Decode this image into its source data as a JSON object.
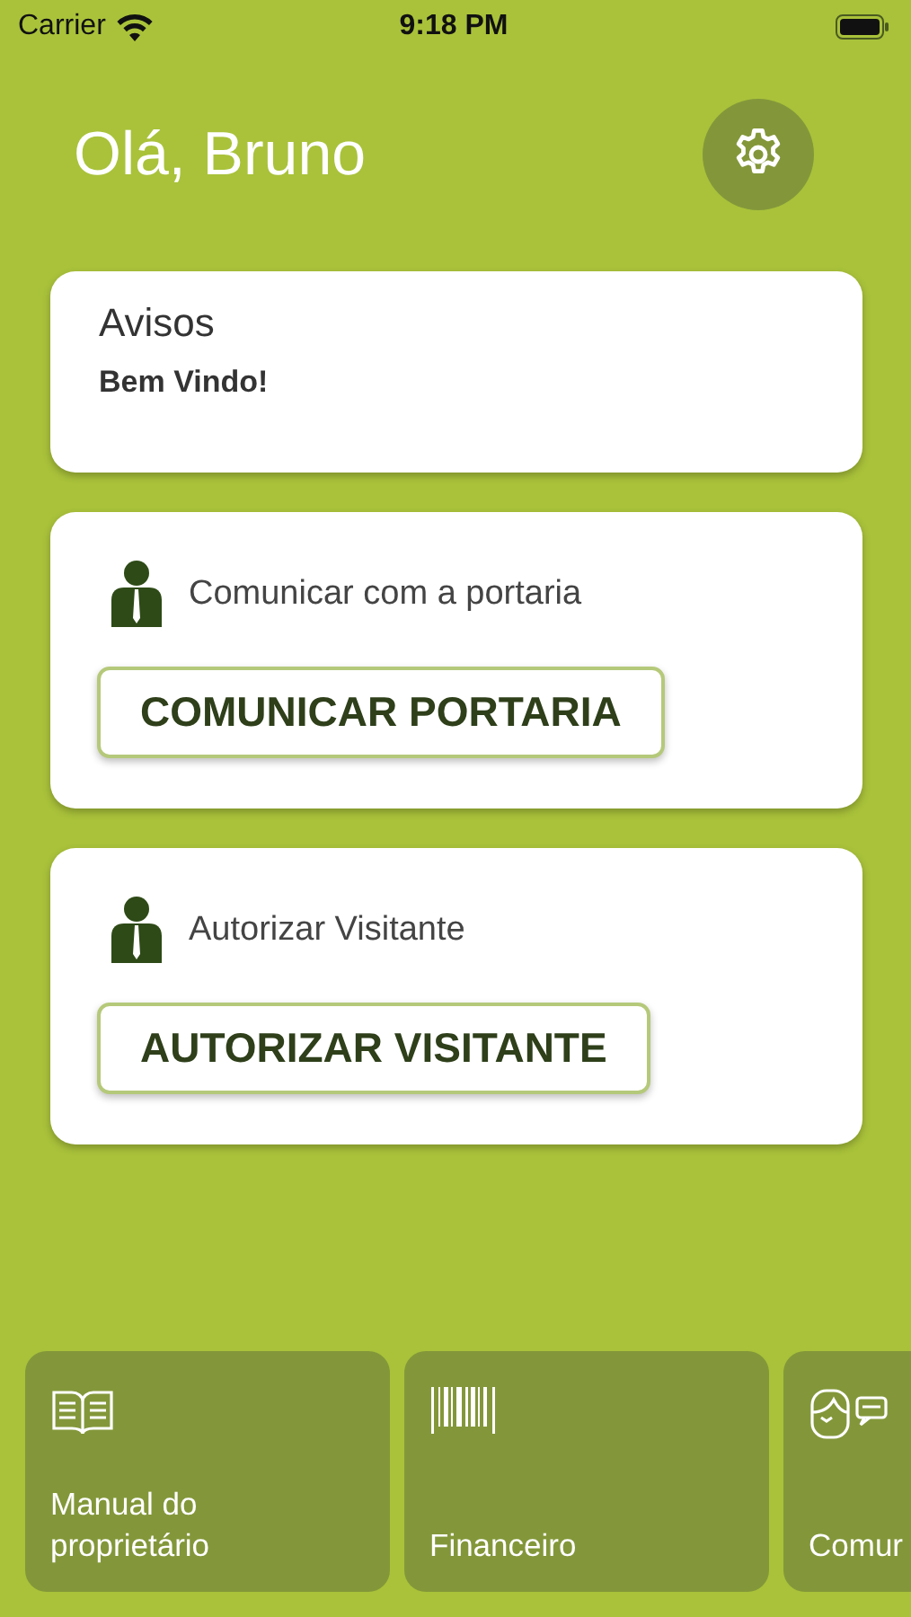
{
  "status_bar": {
    "carrier": "Carrier",
    "time": "9:18 PM"
  },
  "header": {
    "greeting": "Olá, Bruno"
  },
  "notice": {
    "title": "Avisos",
    "message": "Bem Vindo!"
  },
  "actions": [
    {
      "label": "Comunicar com a portaria",
      "button": "COMUNICAR PORTARIA"
    },
    {
      "label": "Autorizar Visitante",
      "button": "AUTORIZAR VISITANTE"
    }
  ],
  "shortcuts": [
    {
      "kind": "book",
      "label": "Manual do proprietário"
    },
    {
      "kind": "barcode",
      "label": "Financeiro"
    },
    {
      "kind": "chat",
      "label": "Comur"
    }
  ]
}
